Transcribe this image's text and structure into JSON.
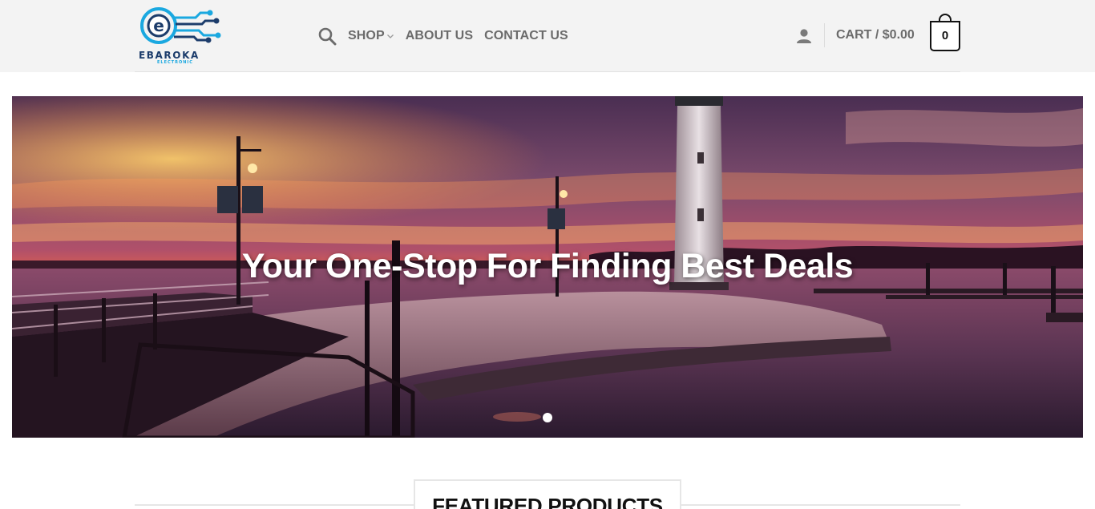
{
  "brand": {
    "name": "EBAROKA",
    "tagline": "ELECTRONIC"
  },
  "nav": {
    "items": [
      {
        "label": "SHOP",
        "has_dropdown": true
      },
      {
        "label": "ABOUT US"
      },
      {
        "label": "CONTACT US"
      }
    ]
  },
  "cart": {
    "label": "CART / $0.00",
    "count": "0"
  },
  "hero": {
    "title": "Your One-Stop For Finding Best Deals",
    "slides_total": 1,
    "active_slide": 1
  },
  "featured": {
    "title": "FEATURED PRODUCTS"
  },
  "colors": {
    "header_bg": "#f3f3f3",
    "nav_text": "#6b6b6b",
    "brand_blue": "#1aa8e0",
    "brand_dark": "#1c3c6b",
    "hero_title": "#ffffff"
  },
  "icons": [
    "search-icon",
    "chevron-down-icon",
    "user-icon",
    "cart-icon"
  ]
}
